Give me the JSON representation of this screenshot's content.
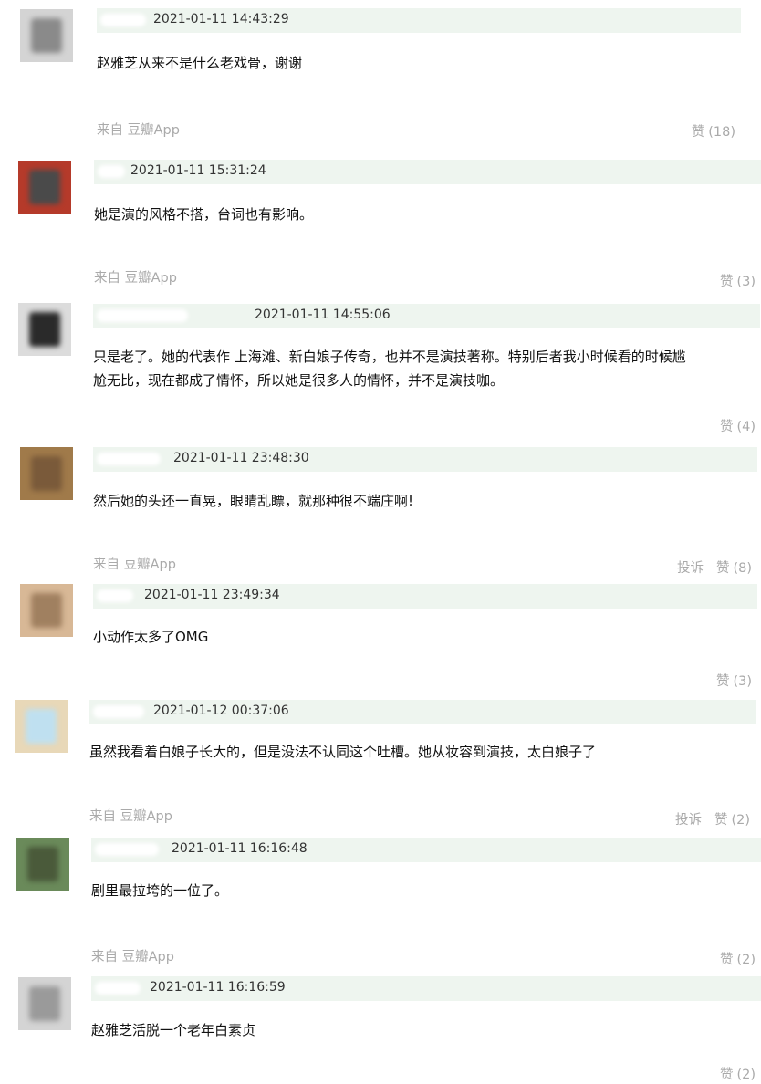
{
  "comments": [
    {
      "time": "2021-01-11 14:43:29",
      "content": "赵雅芝从来不是什么老戏骨，谢谢",
      "source": "来自 豆瓣App",
      "like_label": "赞",
      "like_count": "(18)",
      "report_label": ""
    },
    {
      "time": "2021-01-11 15:31:24",
      "content": "她是演的风格不搭，台词也有影响。",
      "source": "来自 豆瓣App",
      "like_label": "赞",
      "like_count": "(3)",
      "report_label": ""
    },
    {
      "time": "2021-01-11 14:55:06",
      "content_line1": "只是老了。她的代表作 上海滩、新白娘子传奇，也并不是演技著称。特别后者我小时候看的时候尴",
      "content_line2": "尬无比，现在都成了情怀，所以她是很多人的情怀，并不是演技咖。",
      "source": "",
      "like_label": "赞",
      "like_count": "(4)",
      "report_label": ""
    },
    {
      "time": "2021-01-11 23:48:30",
      "content": "然后她的头还一直晃，眼睛乱瞟，就那种很不端庄啊!",
      "source": "来自 豆瓣App",
      "like_label": "赞",
      "like_count": "(8)",
      "report_label": "投诉"
    },
    {
      "time": "2021-01-11 23:49:34",
      "content": "小动作太多了OMG",
      "source": "",
      "like_label": "赞",
      "like_count": "(3)",
      "report_label": ""
    },
    {
      "time": "2021-01-12 00:37:06",
      "content": "虽然我看着白娘子长大的，但是没法不认同这个吐槽。她从妆容到演技，太白娘子了",
      "source": "来自 豆瓣App",
      "like_label": "赞",
      "like_count": "(2)",
      "report_label": "投诉"
    },
    {
      "time": "2021-01-11 16:16:48",
      "content": "剧里最拉垮的一位了。",
      "source": "来自 豆瓣App",
      "like_label": "赞",
      "like_count": "(2)",
      "report_label": ""
    },
    {
      "time": "2021-01-11 16:16:59",
      "content": "赵雅芝活脱一个老年白素贞",
      "source": "",
      "like_label": "赞",
      "like_count": "(2)",
      "report_label": ""
    }
  ],
  "colors": {
    "meta_bar": "#eef5ef",
    "muted_text": "#aaaaaa",
    "body_text": "#111111"
  }
}
